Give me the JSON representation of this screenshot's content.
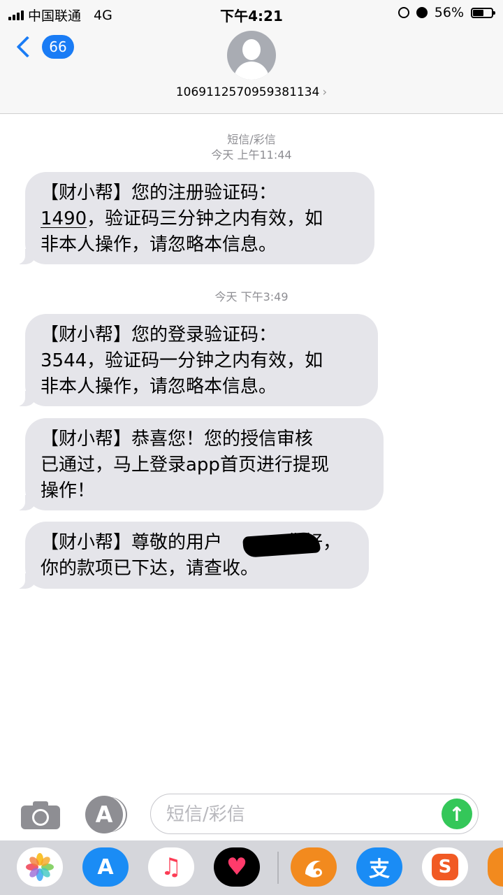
{
  "status_bar": {
    "carrier": "中国联通",
    "network": "4G",
    "time": "下午4:21",
    "battery_percent": "56%",
    "battery_level": 0.56
  },
  "header": {
    "back_badge": "66",
    "contact": "1069112570959381134",
    "chevron": "›"
  },
  "conversation": {
    "service_label": "短信/彩信",
    "messages": [
      {
        "timestamp": "今天 上午11:44",
        "lines": [
          "【财小帮】您的注册验证码：",
          "，验证码三分钟之内有效，如",
          "非本人操作，请忽略本信息。"
        ],
        "code": "1490"
      },
      {
        "timestamp": "今天 下午3:49",
        "lines": [
          "【财小帮】您的登录验证码：",
          "3544，验证码一分钟之内有效，如",
          "非本人操作，请忽略本信息。"
        ]
      },
      {
        "lines": [
          "【财小帮】恭喜您！您的授信审核",
          "已通过，马上登录app首页进行提现",
          "操作！"
        ]
      },
      {
        "lines": [
          "【财小帮】尊敬的用户",
          "您好，",
          "你的款项已下达，请查收。"
        ]
      }
    ]
  },
  "input_bar": {
    "placeholder": "短信/彩信",
    "apps_glyph": "A",
    "send_glyph": "↑"
  },
  "app_drawer": {
    "apps": [
      {
        "name": "photos-icon",
        "color": "#f5a623"
      },
      {
        "name": "app-store-icon",
        "color": "#1a8cf5",
        "glyph": "A"
      },
      {
        "name": "music-icon",
        "color": "#fc3c55",
        "glyph": "♫"
      },
      {
        "name": "heart-app-icon",
        "color": "#000000",
        "glyph": "♥"
      },
      {
        "name": "uc-browser-icon",
        "color": "#f28a1e"
      },
      {
        "name": "alipay-icon",
        "color": "#1a8cf5",
        "glyph": "支"
      },
      {
        "name": "sogou-icon",
        "color": "#f15a24",
        "glyph": "S"
      }
    ]
  },
  "colors": {
    "accent": "#1a7cf5",
    "bubble": "#e5e5ea",
    "send": "#34c759"
  }
}
